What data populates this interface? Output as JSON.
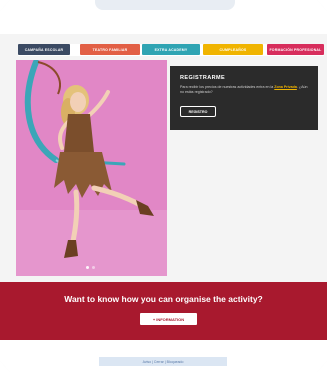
{
  "nav": {
    "tabs": [
      {
        "label": "CAMPAÑA ESCOLAR",
        "color": "#3b4a63"
      },
      {
        "label": "TEATRO FAMILIAR",
        "color": "#e25f45"
      },
      {
        "label": "EXTRA ACADEMY",
        "color": "#2fa4b3"
      },
      {
        "label": "CUMPLEAÑOS",
        "color": "#f0b400"
      },
      {
        "label": "FORMACIÓN PROFESIONAL",
        "color": "#d72d5c"
      }
    ]
  },
  "register": {
    "title": "REGISTRARME",
    "text_before": "Para recibir los precios de nuestras actividades entra en la",
    "link": "Zona Privada",
    "text_after": ". ¿Aún no estás registrado?",
    "button": "REGISTRO"
  },
  "banner": {
    "heading": "Want to know how you can organise the activity?",
    "button_icon": "+",
    "button_label": "INFORMATION"
  },
  "footer": {
    "text": "Aviso | Cerrar | Bloqueado"
  },
  "colors": {
    "banner_bg": "#a8192e",
    "hero_bg": "#e187c6",
    "register_bg": "#2b2b2b"
  }
}
